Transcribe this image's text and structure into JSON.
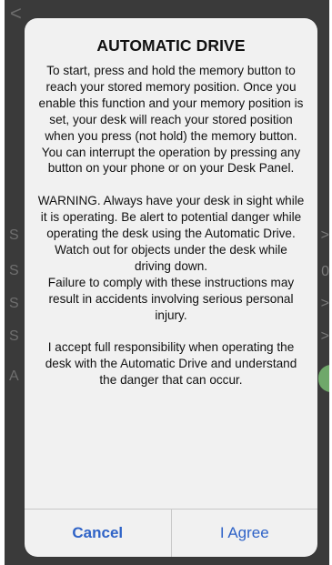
{
  "background": {
    "back_icon": "<",
    "row_letters": [
      "S",
      "S",
      "S",
      "S",
      "A"
    ],
    "right_marks": [
      ">",
      "0",
      ">",
      ">"
    ],
    "toggle_color": "#6fa86a"
  },
  "alert": {
    "title": "AUTOMATIC DRIVE",
    "paragraphs": [
      "To start, press and hold the memory button to reach your stored memory position.  Once you enable this function and your memory position is set, your desk will reach your stored position when you press (not hold) the memory button. You can interrupt the operation by pressing any button on your phone or on your Desk Panel.",
      "WARNING. Always have your desk in sight while it is operating. Be alert to potential danger while operating the desk using the Automatic Drive. Watch out for objects under the desk while driving down.",
      "Failure to comply with these instructions may result in accidents involving serious personal injury.",
      "I accept full responsibility when operating the desk with the Automatic Drive and understand the danger that can occur."
    ],
    "buttons": {
      "cancel": "Cancel",
      "agree": "I Agree"
    },
    "button_color": "#2f63c7"
  }
}
